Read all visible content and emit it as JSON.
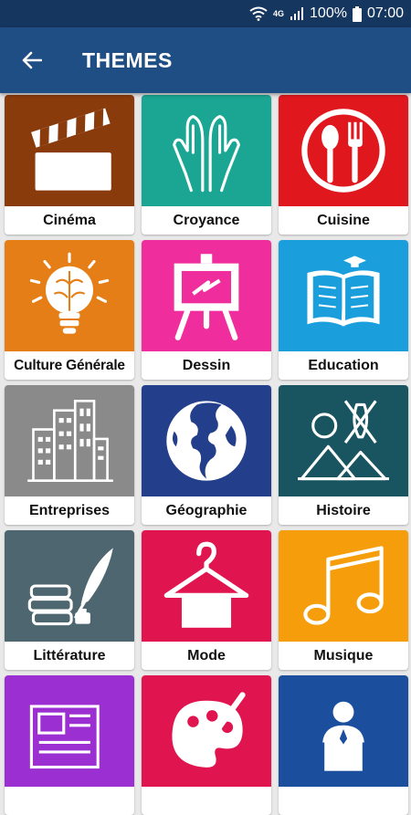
{
  "status": {
    "network": "4G",
    "battery": "100%",
    "time": "07:00"
  },
  "header": {
    "title": "THEMES"
  },
  "colors": {
    "status_bar": "#15365f",
    "app_bar": "#1f4e85"
  },
  "themes": [
    {
      "label": "Cinéma",
      "icon": "clapperboard-icon",
      "color": "#8a3b0c"
    },
    {
      "label": "Croyance",
      "icon": "praying-hands-icon",
      "color": "#1aa693"
    },
    {
      "label": "Cuisine",
      "icon": "plate-utensils-icon",
      "color": "#e0171d"
    },
    {
      "label": "Culture Générale",
      "icon": "brain-lightbulb-icon",
      "color": "#e57e16"
    },
    {
      "label": "Dessin",
      "icon": "easel-icon",
      "color": "#f02d9c"
    },
    {
      "label": "Education",
      "icon": "book-graduation-icon",
      "color": "#1b9fdc"
    },
    {
      "label": "Entreprises",
      "icon": "buildings-icon",
      "color": "#8a8a8a"
    },
    {
      "label": "Géographie",
      "icon": "globe-icon",
      "color": "#233e8a"
    },
    {
      "label": "Histoire",
      "icon": "pyramids-shield-icon",
      "color": "#195461"
    },
    {
      "label": "Littérature",
      "icon": "books-quill-icon",
      "color": "#4d6670"
    },
    {
      "label": "Mode",
      "icon": "hanger-icon",
      "color": "#e0154f"
    },
    {
      "label": "Musique",
      "icon": "music-note-icon",
      "color": "#f59d0a"
    },
    {
      "label": "",
      "icon": "newspaper-icon",
      "color": "#9b2fd1"
    },
    {
      "label": "",
      "icon": "palette-icon",
      "color": "#e0154f"
    },
    {
      "label": "",
      "icon": "speaker-podium-icon",
      "color": "#1b4f9e"
    }
  ]
}
